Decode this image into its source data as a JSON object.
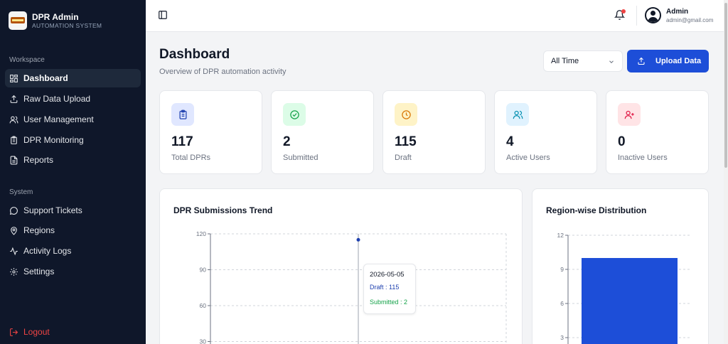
{
  "brand": {
    "title": "DPR Admin",
    "subtitle": "AUTOMATION SYSTEM"
  },
  "sidebar": {
    "workspace_label": "Workspace",
    "workspace_items": [
      {
        "label": "Dashboard",
        "icon": "dashboard-grid-icon",
        "active": true
      },
      {
        "label": "Raw Data Upload",
        "icon": "upload-icon"
      },
      {
        "label": "User Management",
        "icon": "users-icon"
      },
      {
        "label": "DPR Monitoring",
        "icon": "clipboard-icon"
      },
      {
        "label": "Reports",
        "icon": "file-text-icon"
      }
    ],
    "system_label": "System",
    "system_items": [
      {
        "label": "Support Tickets",
        "icon": "message-circle-icon"
      },
      {
        "label": "Regions",
        "icon": "map-pin-icon"
      },
      {
        "label": "Activity Logs",
        "icon": "activity-icon"
      },
      {
        "label": "Settings",
        "icon": "gear-icon"
      }
    ],
    "logout_label": "Logout"
  },
  "topbar": {
    "user_name": "Admin",
    "user_email": "admin@gmail.com"
  },
  "header": {
    "title": "Dashboard",
    "subtitle": "Overview of DPR automation activity",
    "filter_value": "All Time",
    "upload_label": "Upload Data"
  },
  "stats": [
    {
      "value": "117",
      "label": "Total DPRs",
      "icon": "clipboard-list-icon",
      "color": "#1e40af",
      "bg": "#e0e7ff"
    },
    {
      "value": "2",
      "label": "Submitted",
      "icon": "check-circle-icon",
      "color": "#16a34a",
      "bg": "#dcfce7"
    },
    {
      "value": "115",
      "label": "Draft",
      "icon": "clock-icon",
      "color": "#d97706",
      "bg": "#fef3c7"
    },
    {
      "value": "4",
      "label": "Active Users",
      "icon": "users-icon",
      "color": "#0891b2",
      "bg": "#e0f2fe"
    },
    {
      "value": "0",
      "label": "Inactive Users",
      "icon": "user-plus-icon",
      "color": "#e11d48",
      "bg": "#ffe4e6"
    }
  ],
  "trend_panel": {
    "title": "DPR Submissions Trend",
    "tooltip": {
      "date": "2026-05-05",
      "draft": "Draft : 115",
      "submitted": "Submitted : 2"
    }
  },
  "region_panel": {
    "title": "Region-wise Distribution"
  },
  "chart_data": [
    {
      "type": "line",
      "title": "DPR Submissions Trend",
      "x": [
        "2026-05-05"
      ],
      "series": [
        {
          "name": "Draft",
          "values": [
            115
          ],
          "color": "#1e40af"
        },
        {
          "name": "Submitted",
          "values": [
            2
          ],
          "color": "#16a34a"
        }
      ],
      "yticks": [
        30,
        60,
        90,
        120
      ],
      "ylim": [
        0,
        120
      ],
      "grid": true
    },
    {
      "type": "bar",
      "title": "Region-wise Distribution",
      "categories": [
        ""
      ],
      "values": [
        10
      ],
      "color": "#1d4ed8",
      "yticks": [
        3,
        6,
        9,
        12
      ],
      "ylim": [
        0,
        12
      ],
      "grid": true
    }
  ]
}
